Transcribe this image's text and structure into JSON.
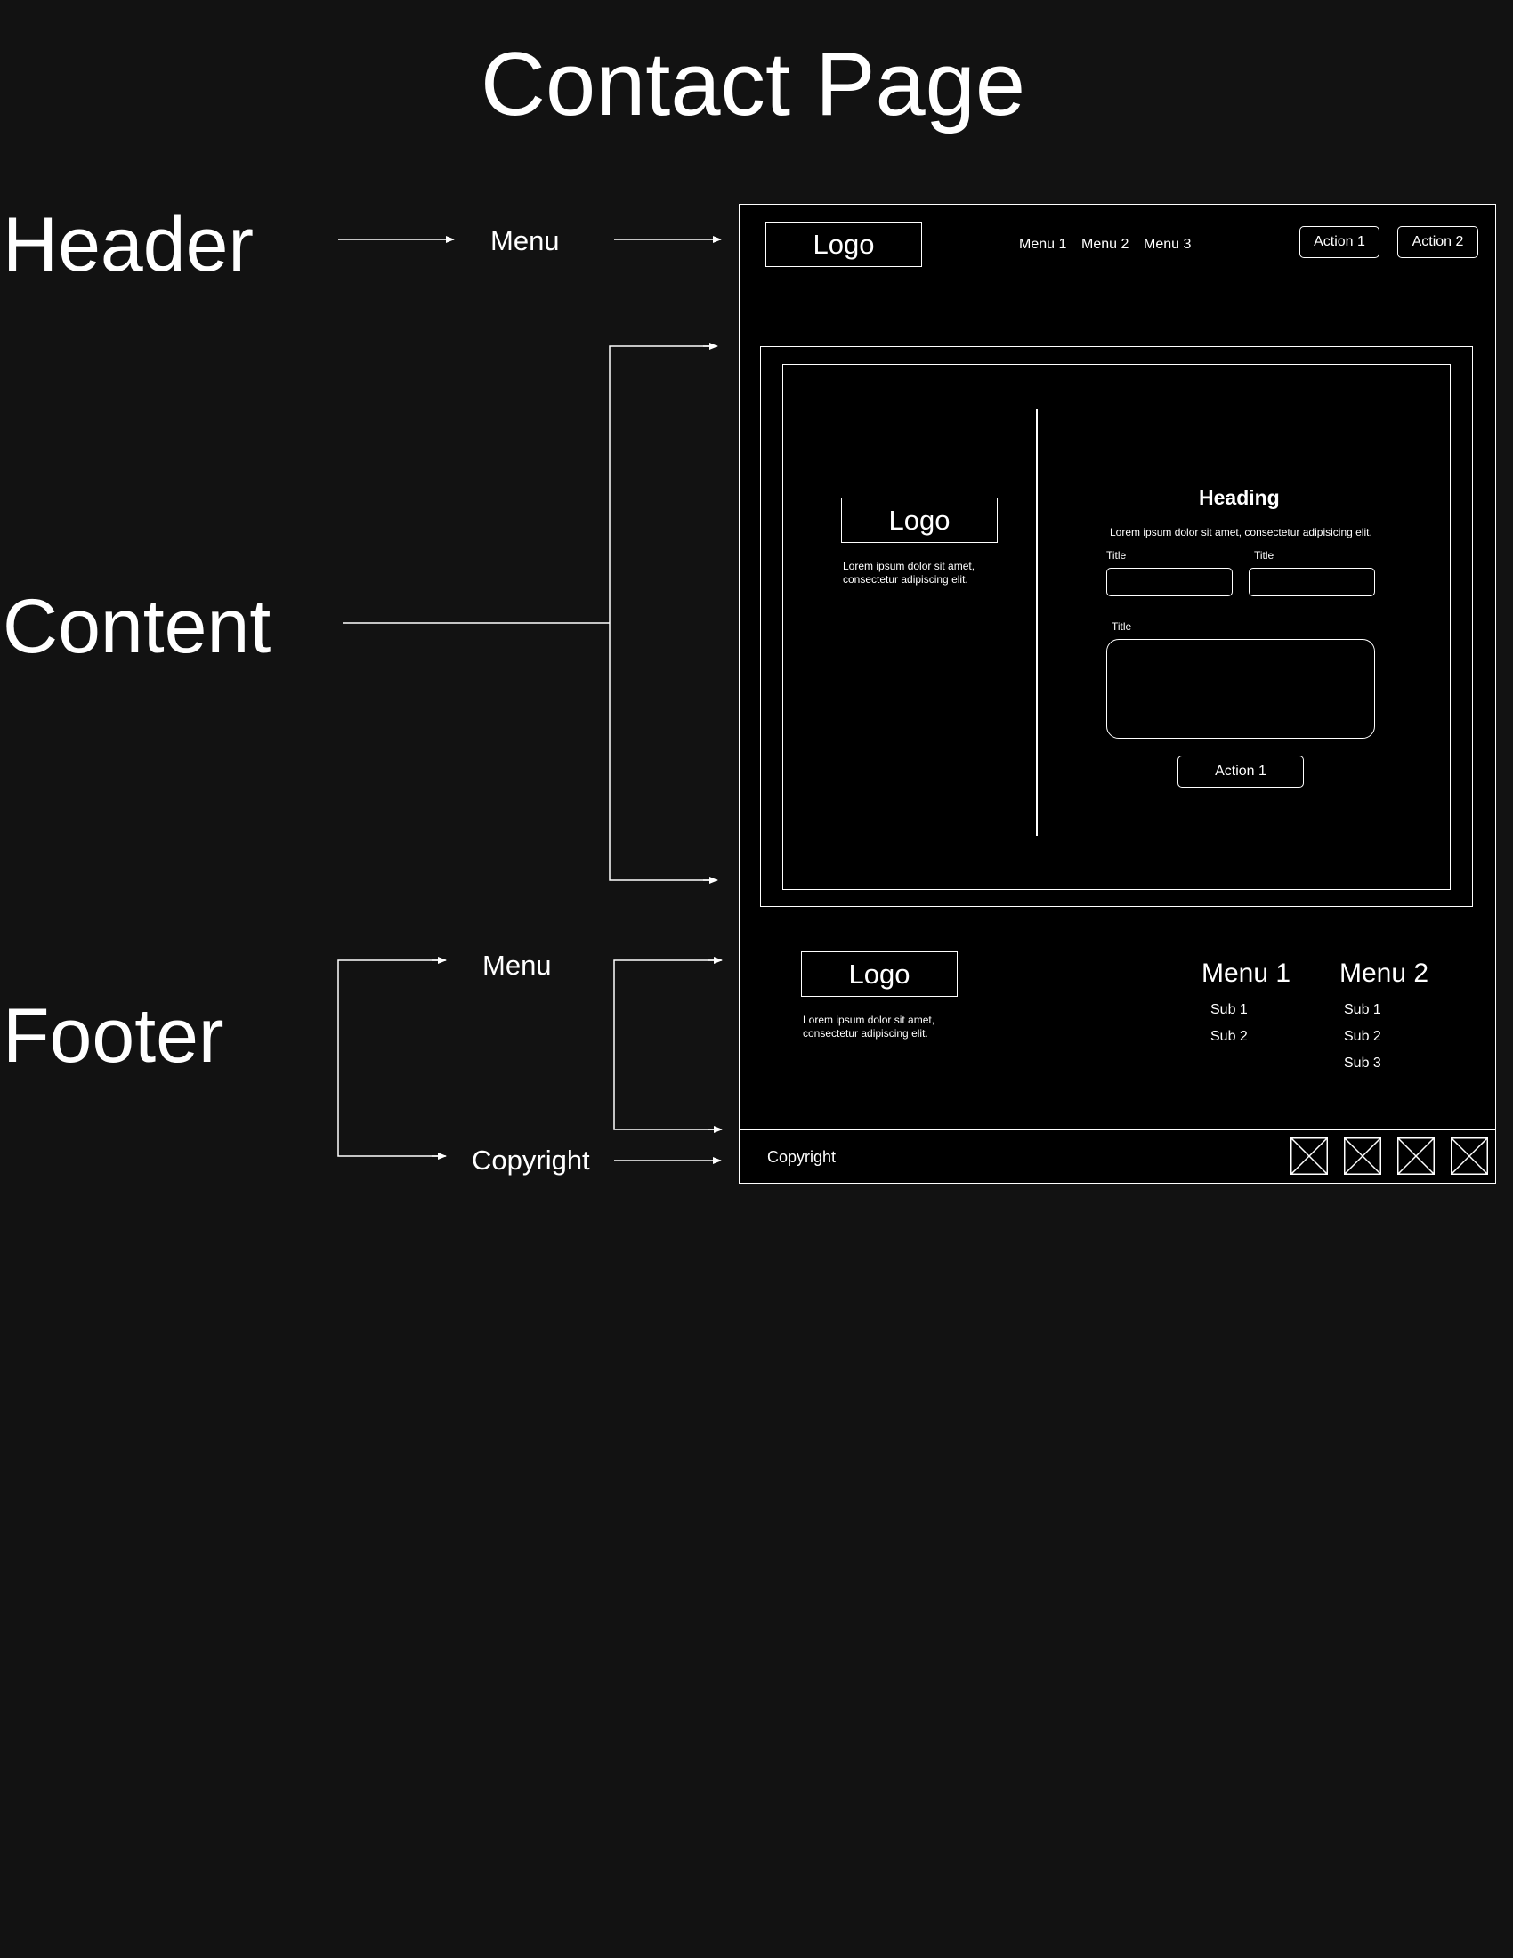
{
  "page_title": "Contact Page",
  "sections": {
    "header": "Header",
    "content": "Content",
    "footer": "Footer"
  },
  "annotations": {
    "header_menu": "Menu",
    "footer_menu": "Menu",
    "footer_copyright": "Copyright"
  },
  "wireframe": {
    "header": {
      "logo": "Logo",
      "menu": [
        "Menu 1",
        "Menu 2",
        "Menu 3"
      ],
      "actions": [
        "Action 1",
        "Action 2"
      ]
    },
    "content": {
      "logo": "Logo",
      "intro_text": "Lorem ipsum dolor sit amet, consectetur adipiscing elit.",
      "heading": "Heading",
      "subtext": "Lorem ipsum dolor sit amet, consectetur adipisicing elit.",
      "field_labels": [
        "Title",
        "Title",
        "Title"
      ],
      "submit_label": "Action 1"
    },
    "footer": {
      "logo": "Logo",
      "intro_text": "Lorem ipsum dolor sit amet, consectetur adipiscing elit.",
      "menus": [
        {
          "title": "Menu 1",
          "items": [
            "Sub 1",
            "Sub 2"
          ]
        },
        {
          "title": "Menu 2",
          "items": [
            "Sub 1",
            "Sub 2",
            "Sub 3"
          ]
        }
      ],
      "copyright": "Copyright",
      "social_icon_count": 4
    }
  },
  "colors": {
    "background": "#121212",
    "wireframe_bg": "#000000",
    "stroke": "#ffffff"
  }
}
